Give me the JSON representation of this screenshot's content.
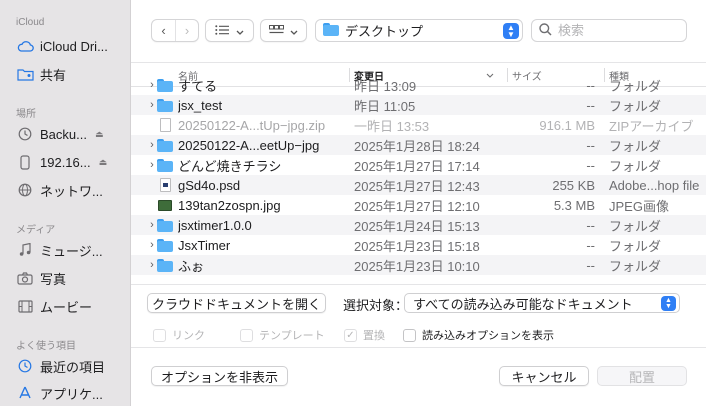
{
  "sidebar": {
    "sections": [
      {
        "label": "iCloud"
      },
      {
        "label": "場所"
      },
      {
        "label": "メディア"
      },
      {
        "label": "よく使う項目"
      }
    ],
    "items": [
      {
        "label": "iCloud Dri...",
        "icon": "cloud-icon"
      },
      {
        "label": "共有",
        "icon": "shared-folder-icon"
      },
      {
        "label": "Backu...",
        "icon": "clock-icon",
        "eject": "⏏"
      },
      {
        "label": "192.16...",
        "icon": "phone-icon",
        "eject": "⏏"
      },
      {
        "label": "ネットワ...",
        "icon": "globe-icon"
      },
      {
        "label": "ミュージ...",
        "icon": "music-icon"
      },
      {
        "label": "写真",
        "icon": "camera-icon"
      },
      {
        "label": "ムービー",
        "icon": "film-icon"
      },
      {
        "label": "最近の項目",
        "icon": "clock-icon"
      },
      {
        "label": "アプリケ...",
        "icon": "apps-icon"
      }
    ]
  },
  "toolbar": {
    "back": "‹",
    "forward": "›",
    "path": "デスクトップ",
    "search_placeholder": "検索"
  },
  "columns": {
    "name": "名前",
    "date": "変更日",
    "size": "サイズ",
    "kind": "種類"
  },
  "files": [
    {
      "name": "すてる",
      "date": "昨日 13:09",
      "size": "--",
      "kind": "フォルダ",
      "type": "folder",
      "disc": "›"
    },
    {
      "name": "jsx_test",
      "date": "昨日 11:05",
      "size": "--",
      "kind": "フォルダ",
      "type": "folder",
      "disc": "›"
    },
    {
      "name": "20250122-A...tUp−jpg.zip",
      "date": "一昨日 13:53",
      "size": "916.1 MB",
      "kind": "ZIPアーカイブ",
      "type": "zip",
      "disc": ""
    },
    {
      "name": "20250122-A...eetUp−jpg",
      "date": "2025年1月28日 18:24",
      "size": "--",
      "kind": "フォルダ",
      "type": "folder",
      "disc": "›"
    },
    {
      "name": "どんど焼きチラシ",
      "date": "2025年1月27日 17:14",
      "size": "--",
      "kind": "フォルダ",
      "type": "folder",
      "disc": "›"
    },
    {
      "name": "gSd4o.psd",
      "date": "2025年1月27日 12:43",
      "size": "255 KB",
      "kind": "Adobe...hop file",
      "type": "psd",
      "disc": ""
    },
    {
      "name": "139tan2zospn.jpg",
      "date": "2025年1月27日 12:10",
      "size": "5.3 MB",
      "kind": "JPEG画像",
      "type": "jpg",
      "disc": ""
    },
    {
      "name": "jsxtimer1.0.0",
      "date": "2025年1月24日 15:13",
      "size": "--",
      "kind": "フォルダ",
      "type": "folder",
      "disc": "›"
    },
    {
      "name": "JsxTimer",
      "date": "2025年1月23日 15:18",
      "size": "--",
      "kind": "フォルダ",
      "type": "folder",
      "disc": "›"
    },
    {
      "name": "ふぉ",
      "date": "2025年1月23日 10:10",
      "size": "--",
      "kind": "フォルダ",
      "type": "folder",
      "disc": "›"
    }
  ],
  "controls": {
    "cloud_docs_button": "クラウドドキュメントを開く",
    "selection_label": "選択対象：",
    "selection_value": "すべての読み込み可能なドキュメント",
    "link_label": "リンク",
    "template_label": "テンプレート",
    "replace_label": "置換",
    "import_options_label": "読み込みオプションを表示",
    "hide_options_button": "オプションを非表示",
    "cancel_button": "キャンセル",
    "place_button": "配置"
  },
  "colors": {
    "accent": "#2f7ff5",
    "folder": "#5bb4f7",
    "sidebar_bg": "#e6e4e6"
  }
}
